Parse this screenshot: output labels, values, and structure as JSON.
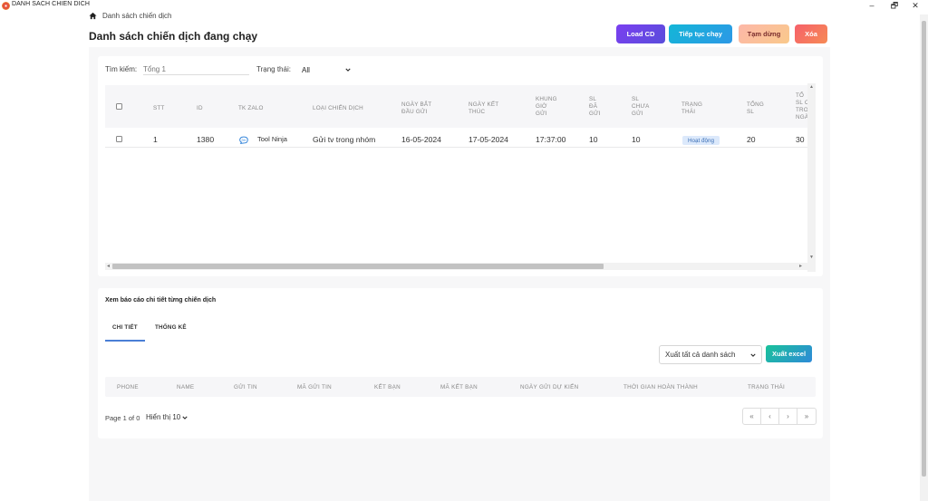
{
  "window": {
    "title": "DANH SACH CHIEN DICH",
    "minimize": "–",
    "restore": "🗗",
    "close": "✕"
  },
  "breadcrumb": {
    "label": "Danh sách chiến dịch"
  },
  "page": {
    "title": "Danh sách chiến dịch đang chạy"
  },
  "actions": {
    "load": "Load CD",
    "continue": "Tiếp tục chạy",
    "pause": "Tạm dừng",
    "delete": "Xóa"
  },
  "filters": {
    "search_label": "Tìm kiếm:",
    "search_placeholder": "Tổng 1",
    "status_label": "Trạng thái:",
    "status_value": "All"
  },
  "table": {
    "headers": {
      "stt": "STT",
      "id": "ID",
      "tk_zalo": "TK ZALO",
      "type": "LOẠI CHIẾN DỊCH",
      "start_1": "NGÀY BẮT",
      "start_2": "ĐẦU GỬI",
      "end_1": "NGÀY KẾT",
      "end_2": "THÚC",
      "frame_1": "KHUNG",
      "frame_2": "GIỜ",
      "frame_3": "GỬI",
      "sent_1": "SL",
      "sent_2": "ĐÃ",
      "sent_3": "GỬI",
      "unsent_1": "SL",
      "unsent_2": "CHƯA",
      "unsent_3": "GỬI",
      "status_1": "TRẠNG",
      "status_2": "THÁI",
      "total_1": "TỔNG",
      "total_2": "SL",
      "extra_1": "TỔ",
      "extra_2": "SL C",
      "extra_3": "TRO",
      "extra_4": "NGÀ"
    },
    "rows": [
      {
        "stt": "1",
        "id": "1380",
        "tk_zalo": "Tool Ninja",
        "zalo_icon_text": "Zalo",
        "type": "Gửi tv trong nhóm",
        "start": "16-05-2024",
        "end": "17-05-2024",
        "frame": "17:37:00",
        "sent": "10",
        "unsent": "10",
        "status": "Hoạt động",
        "total": "20",
        "extra": "30"
      }
    ]
  },
  "report": {
    "title": "Xem báo cáo chi tiết từng chiến dịch",
    "tabs": [
      "CHI TIẾT",
      "THỐNG KÊ"
    ],
    "export_option": "Xuất tất cả danh sách",
    "export_button": "Xuất excel",
    "headers": [
      "PHONE",
      "NAME",
      "GỬI TIN",
      "MÃ GỬI TIN",
      "KẾT BẠN",
      "MÃ KẾT BẠN",
      "NGÀY GỬI DỰ KIẾN",
      "THỜI GIAN HOÀN THÀNH",
      "TRẠNG THÁI"
    ],
    "page_info": "Page 1 of 0",
    "page_size": "Hiển thị 10",
    "pager": [
      "«",
      "‹",
      "›",
      "»"
    ]
  },
  "colors": {
    "load": "#6a46e6",
    "continue": "#1fa8de",
    "pause": "#fbbf9b",
    "delete": "#f6706a",
    "export": "#1fb0b0",
    "badge_bg": "#dce9fb"
  }
}
